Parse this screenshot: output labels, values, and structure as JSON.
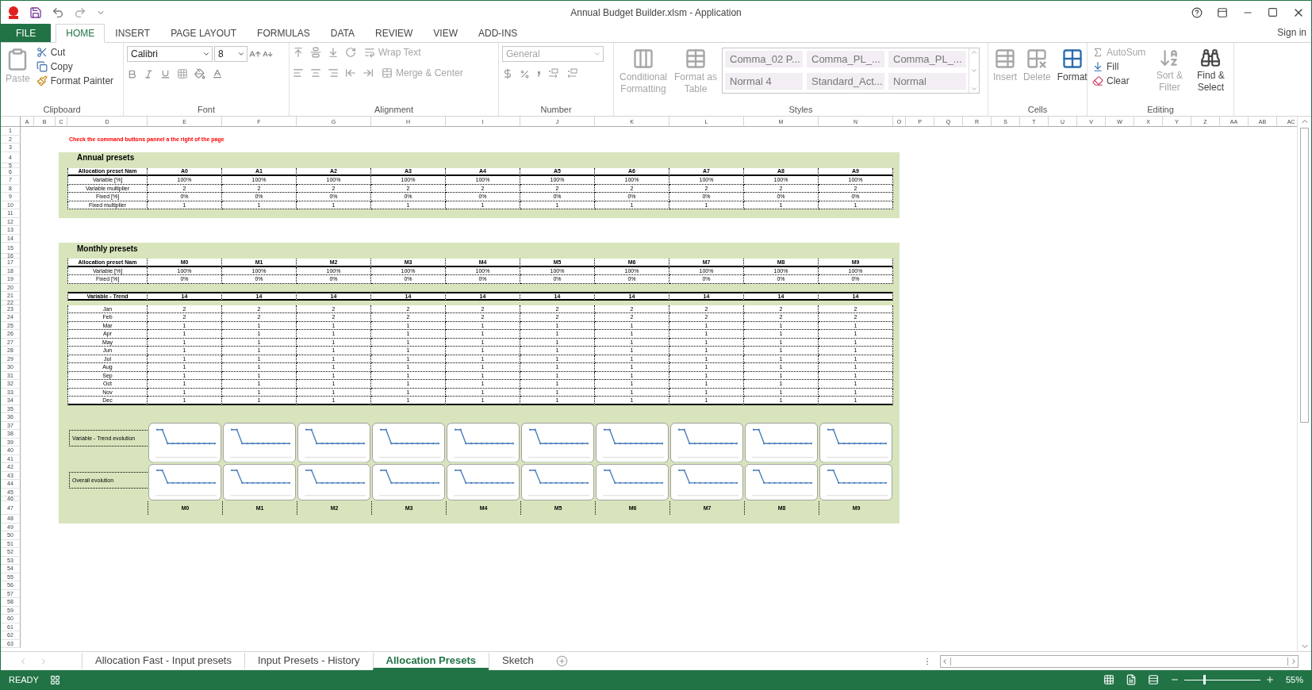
{
  "window": {
    "title": "Annual Budget Builder.xlsm - Application"
  },
  "ribbon_tabs": [
    {
      "label": "FILE",
      "kind": "file",
      "selected": false
    },
    {
      "label": "HOME",
      "kind": "tab",
      "selected": true
    },
    {
      "label": "INSERT",
      "kind": "tab",
      "selected": false
    },
    {
      "label": "PAGE LAYOUT",
      "kind": "tab",
      "selected": false
    },
    {
      "label": "FORMULAS",
      "kind": "tab",
      "selected": false
    },
    {
      "label": "DATA",
      "kind": "tab",
      "selected": false
    },
    {
      "label": "REVIEW",
      "kind": "tab",
      "selected": false
    },
    {
      "label": "VIEW",
      "kind": "tab",
      "selected": false
    },
    {
      "label": "ADD-INS",
      "kind": "tab",
      "selected": false
    }
  ],
  "account": {
    "label": "Sign in"
  },
  "ribbon": {
    "clipboard": {
      "label": "Clipboard",
      "paste": {
        "label": "Paste",
        "disabled": true
      },
      "actions": [
        {
          "label": "Cut",
          "disabled": false
        },
        {
          "label": "Copy",
          "disabled": false
        },
        {
          "label": "Format Painter",
          "disabled": false
        }
      ]
    },
    "font": {
      "label": "Font",
      "name": "Calibri",
      "size": "8"
    },
    "alignment": {
      "label": "Alignment",
      "actions": [
        {
          "label": "Wrap Text",
          "disabled": true
        },
        {
          "label": "Merge & Center",
          "disabled": true
        }
      ]
    },
    "number": {
      "label": "Number",
      "format": "General"
    },
    "styles": {
      "label": "Styles",
      "actions": [
        {
          "label": "Conditional Formatting",
          "disabled": true
        },
        {
          "label": "Format as Table",
          "disabled": true
        }
      ],
      "gallery": [
        "Comma_02 P...",
        "Comma_PL_...",
        "Comma_PL_...",
        "Normal 4",
        "Standard_Act...",
        "Normal"
      ]
    },
    "cells": {
      "label": "Cells",
      "actions": [
        {
          "label": "Insert",
          "disabled": true
        },
        {
          "label": "Delete",
          "disabled": true
        },
        {
          "label": "Format",
          "disabled": false
        }
      ]
    },
    "editing": {
      "label": "Editing",
      "actions": [
        {
          "label": "AutoSum",
          "disabled": true
        },
        {
          "label": "Fill",
          "disabled": false
        },
        {
          "label": "Clear",
          "disabled": false
        },
        {
          "label": "Sort & Filter",
          "disabled": true
        },
        {
          "label": "Find & Select",
          "disabled": false
        }
      ]
    }
  },
  "columns": [
    "A",
    "B",
    "C",
    "D",
    "E",
    "F",
    "G",
    "H",
    "I",
    "J",
    "K",
    "L",
    "M",
    "N",
    "O",
    "P",
    "Q",
    "R",
    "S",
    "T",
    "U",
    "V",
    "W",
    "X",
    "Y",
    "Z",
    "AA",
    "AB",
    "AC"
  ],
  "row_numbers": [
    "1",
    "2",
    "3",
    "4",
    "5",
    "6",
    "7",
    "8",
    "9",
    "10",
    "11",
    "12",
    "13",
    "14",
    "15",
    "16",
    "17",
    "18",
    "19",
    "20",
    "21",
    "22",
    "23",
    "24",
    "25",
    "26",
    "27",
    "28",
    "29",
    "30",
    "31",
    "32",
    "33",
    "34",
    "35",
    "36",
    "37",
    "38",
    "39",
    "40",
    "41",
    "42",
    "43",
    "44",
    "45",
    "46",
    "47",
    "48",
    "49",
    "50",
    "51",
    "52",
    "53",
    "54",
    "55",
    "56",
    "57",
    "58",
    "59",
    "60",
    "61",
    "62",
    "63"
  ],
  "sheet": {
    "note": "Check the command buttons pannel a the right of the page",
    "annual": {
      "title": "Annual presets",
      "columns": [
        "Allocation preset Nam",
        "A0",
        "A1",
        "A2",
        "A3",
        "A4",
        "A5",
        "A6",
        "A7",
        "A8",
        "A9"
      ],
      "rows": [
        [
          "Variable [%]",
          "100%",
          "100%",
          "100%",
          "100%",
          "100%",
          "100%",
          "100%",
          "100%",
          "100%",
          "100%"
        ],
        [
          "Variable multiplier",
          "2",
          "2",
          "2",
          "2",
          "2",
          "2",
          "2",
          "2",
          "2",
          "2"
        ],
        [
          "Fixed [%]",
          "0%",
          "0%",
          "0%",
          "0%",
          "0%",
          "0%",
          "0%",
          "0%",
          "0%",
          "0%"
        ],
        [
          "Fixed multiplier",
          "1",
          "1",
          "1",
          "1",
          "1",
          "1",
          "1",
          "1",
          "1",
          "1"
        ]
      ]
    },
    "monthly": {
      "title": "Monthly presets",
      "columns": [
        "Allocation preset Nam",
        "M0",
        "M1",
        "M2",
        "M3",
        "M4",
        "M5",
        "M6",
        "M7",
        "M8",
        "M9"
      ],
      "rows": [
        [
          "Variable [%]",
          "100%",
          "100%",
          "100%",
          "100%",
          "100%",
          "100%",
          "100%",
          "100%",
          "100%",
          "100%"
        ],
        [
          "Fixed [%]",
          "0%",
          "0%",
          "0%",
          "0%",
          "0%",
          "0%",
          "0%",
          "0%",
          "0%",
          "0%"
        ]
      ],
      "trend": {
        "columns": [
          "Variable - Trend",
          "14",
          "14",
          "14",
          "14",
          "14",
          "14",
          "14",
          "14",
          "14",
          "14"
        ],
        "rows": [
          [
            "Jan",
            "2",
            "2",
            "2",
            "2",
            "2",
            "2",
            "2",
            "2",
            "2",
            "2"
          ],
          [
            "Feb",
            "2",
            "2",
            "2",
            "2",
            "2",
            "2",
            "2",
            "2",
            "2",
            "2"
          ],
          [
            "Mar",
            "1",
            "1",
            "1",
            "1",
            "1",
            "1",
            "1",
            "1",
            "1",
            "1"
          ],
          [
            "Apr",
            "1",
            "1",
            "1",
            "1",
            "1",
            "1",
            "1",
            "1",
            "1",
            "1"
          ],
          [
            "May",
            "1",
            "1",
            "1",
            "1",
            "1",
            "1",
            "1",
            "1",
            "1",
            "1"
          ],
          [
            "Jun",
            "1",
            "1",
            "1",
            "1",
            "1",
            "1",
            "1",
            "1",
            "1",
            "1"
          ],
          [
            "Jul",
            "1",
            "1",
            "1",
            "1",
            "1",
            "1",
            "1",
            "1",
            "1",
            "1"
          ],
          [
            "Aug",
            "1",
            "1",
            "1",
            "1",
            "1",
            "1",
            "1",
            "1",
            "1",
            "1"
          ],
          [
            "Sep",
            "1",
            "1",
            "1",
            "1",
            "1",
            "1",
            "1",
            "1",
            "1",
            "1"
          ],
          [
            "Oct",
            "1",
            "1",
            "1",
            "1",
            "1",
            "1",
            "1",
            "1",
            "1",
            "1"
          ],
          [
            "Nov",
            "1",
            "1",
            "1",
            "1",
            "1",
            "1",
            "1",
            "1",
            "1",
            "1"
          ],
          [
            "Dec",
            "1",
            "1",
            "1",
            "1",
            "1",
            "1",
            "1",
            "1",
            "1",
            "1"
          ]
        ]
      },
      "evolution": {
        "rows": [
          {
            "label": "Variable - Trend evolution"
          },
          {
            "label": "Overall evolution"
          }
        ],
        "labels": [
          "M0",
          "M1",
          "M2",
          "M3",
          "M4",
          "M5",
          "M6",
          "M7",
          "M8",
          "M9"
        ]
      }
    }
  },
  "sheet_tabs": [
    {
      "label": "Allocation Fast - Input presets",
      "selected": false
    },
    {
      "label": "Input Presets - History",
      "selected": false
    },
    {
      "label": "Allocation Presets",
      "selected": true
    },
    {
      "label": "Sketch",
      "selected": false
    }
  ],
  "status_bar": {
    "status": "READY",
    "zoom_slider": {
      "level": 0.26
    },
    "zoom": "55%"
  }
}
